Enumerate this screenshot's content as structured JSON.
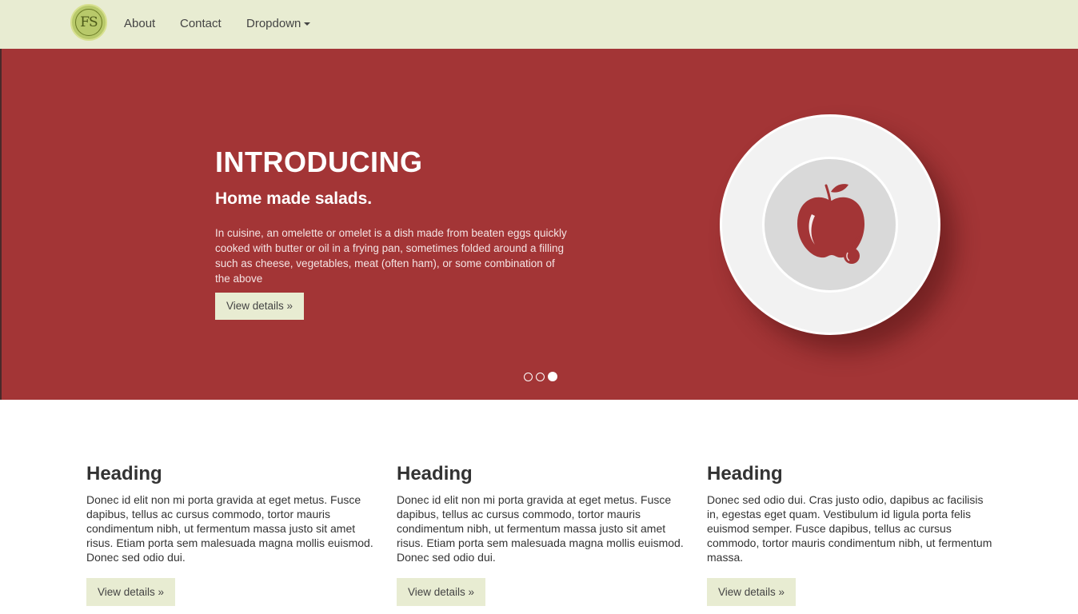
{
  "navbar": {
    "logo_text": "FS",
    "links": [
      {
        "label": "About"
      },
      {
        "label": "Contact"
      },
      {
        "label": "Dropdown"
      }
    ]
  },
  "hero": {
    "title": "INTRODUCING",
    "subtitle": "Home made salads.",
    "body": "In cuisine, an omelette or omelet is a dish made from beaten eggs quickly cooked with butter or oil in a frying pan, sometimes folded around a filling such as cheese, vegetables, meat (often ham), or some combination of the above",
    "button_label": "View details »",
    "image_icon": "apple-icon",
    "carousel": {
      "slides": 3,
      "active_index": 3
    }
  },
  "columns": [
    {
      "heading": "Heading",
      "text": "Donec id elit non mi porta gravida at eget metus. Fusce dapibus, tellus ac cursus commodo, tortor mauris condimentum nibh, ut fermentum massa justo sit amet risus. Etiam porta sem malesuada magna mollis euismod. Donec sed odio dui.",
      "button_label": "View details »"
    },
    {
      "heading": "Heading",
      "text": "Donec id elit non mi porta gravida at eget metus. Fusce dapibus, tellus ac cursus commodo, tortor mauris condimentum nibh, ut fermentum massa justo sit amet risus. Etiam porta sem malesuada magna mollis euismod. Donec sed odio dui.",
      "button_label": "View details »"
    },
    {
      "heading": "Heading",
      "text": "Donec sed odio dui. Cras justo odio, dapibus ac facilisis in, egestas eget quam. Vestibulum id ligula porta felis euismod semper. Fusce dapibus, tellus ac cursus commodo, tortor mauris condimentum nibh, ut fermentum massa.",
      "button_label": "View details »"
    }
  ],
  "colors": {
    "navbar_bg": "#e8ecd2",
    "hero_bg": "#a33536",
    "logo_bg": "#b8c96a",
    "button_bg": "#e8ecd2"
  }
}
